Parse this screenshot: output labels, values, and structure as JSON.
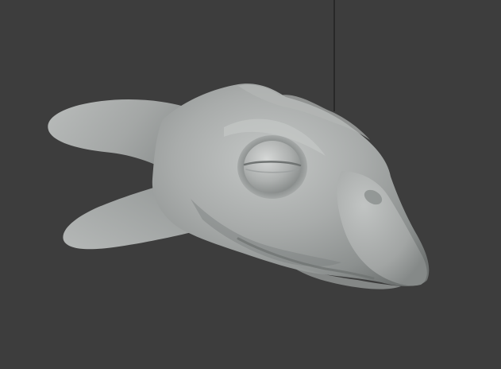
{
  "viewport": {
    "background_color": "#3d3d3d",
    "object": "sculpted-creature-head",
    "object_color": "#a7aaa9",
    "object_shadow_color": "#7e8281",
    "object_highlight_color": "#c9cbca",
    "vertical_line_color": "#1a1a1a"
  }
}
